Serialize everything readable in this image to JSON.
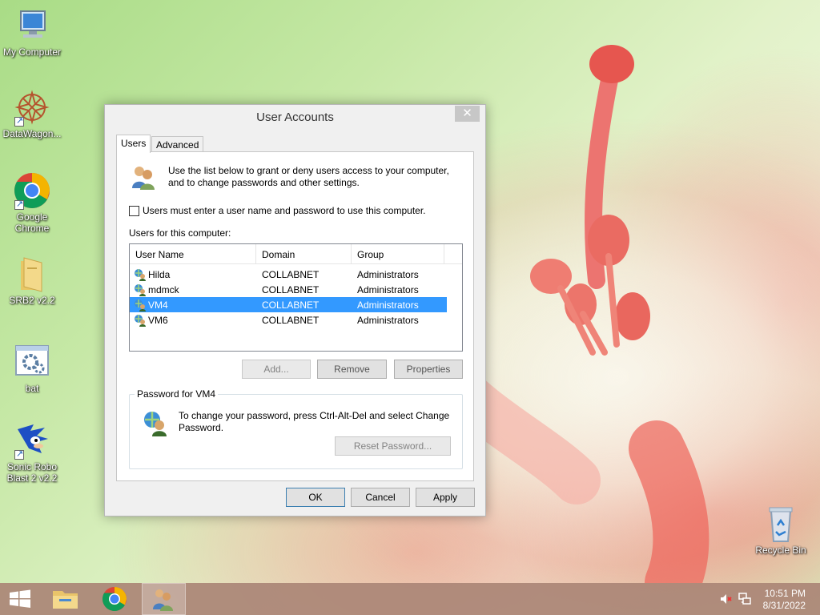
{
  "desktop": {
    "icons": [
      {
        "label": "My Computer",
        "icon": "computer-icon"
      },
      {
        "label": "DataWagon...",
        "icon": "datawagon-icon"
      },
      {
        "label": "Google Chrome",
        "icon": "chrome-icon"
      },
      {
        "label": "SRB2 v2.2",
        "icon": "folder-icon"
      },
      {
        "label": "bat",
        "icon": "batch-file-icon"
      },
      {
        "label": "Sonic Robo Blast 2 v2.2",
        "icon": "sonic-icon"
      },
      {
        "label": "Recycle Bin",
        "icon": "recycle-bin-icon"
      }
    ]
  },
  "dialog": {
    "title": "User Accounts",
    "close_glyph": "✕",
    "tabs": [
      {
        "label": "Users",
        "active": true
      },
      {
        "label": "Advanced",
        "active": false
      }
    ],
    "intro_text": "Use the list below to grant or deny users access to your computer, and to change passwords and other settings.",
    "require_login_checkbox": {
      "label": "Users must enter a user name and password to use this computer.",
      "checked": false
    },
    "users_list_label": "Users for this computer:",
    "users_table": {
      "columns": [
        "User Name",
        "Domain",
        "Group"
      ],
      "rows": [
        {
          "user": "Hilda",
          "domain": "COLLABNET",
          "group": "Administrators",
          "selected": false
        },
        {
          "user": "mdmck",
          "domain": "COLLABNET",
          "group": "Administrators",
          "selected": false
        },
        {
          "user": "VM4",
          "domain": "COLLABNET",
          "group": "Administrators",
          "selected": true
        },
        {
          "user": "VM6",
          "domain": "COLLABNET",
          "group": "Administrators",
          "selected": false
        }
      ]
    },
    "list_buttons": {
      "add": "Add...",
      "remove": "Remove",
      "properties": "Properties"
    },
    "password_group": {
      "title": "Password for VM4",
      "text": "To change your password, press Ctrl-Alt-Del and select Change Password.",
      "reset_button": "Reset Password..."
    },
    "footer_buttons": {
      "ok": "OK",
      "cancel": "Cancel",
      "apply": "Apply"
    }
  },
  "taskbar": {
    "items": [
      {
        "name": "start-button",
        "icon": "windows-logo-icon"
      },
      {
        "name": "file-explorer",
        "icon": "file-explorer-icon"
      },
      {
        "name": "chrome",
        "icon": "chrome-icon"
      },
      {
        "name": "user-accounts",
        "icon": "users-icon",
        "active": true
      }
    ],
    "tray": {
      "volume_icon": "volume-muted-icon",
      "network_icon": "network-icon"
    },
    "clock": {
      "time": "10:51 PM",
      "date": "8/31/2022"
    }
  },
  "colors": {
    "selection": "#3399ff",
    "taskbar": "#aa8676"
  }
}
